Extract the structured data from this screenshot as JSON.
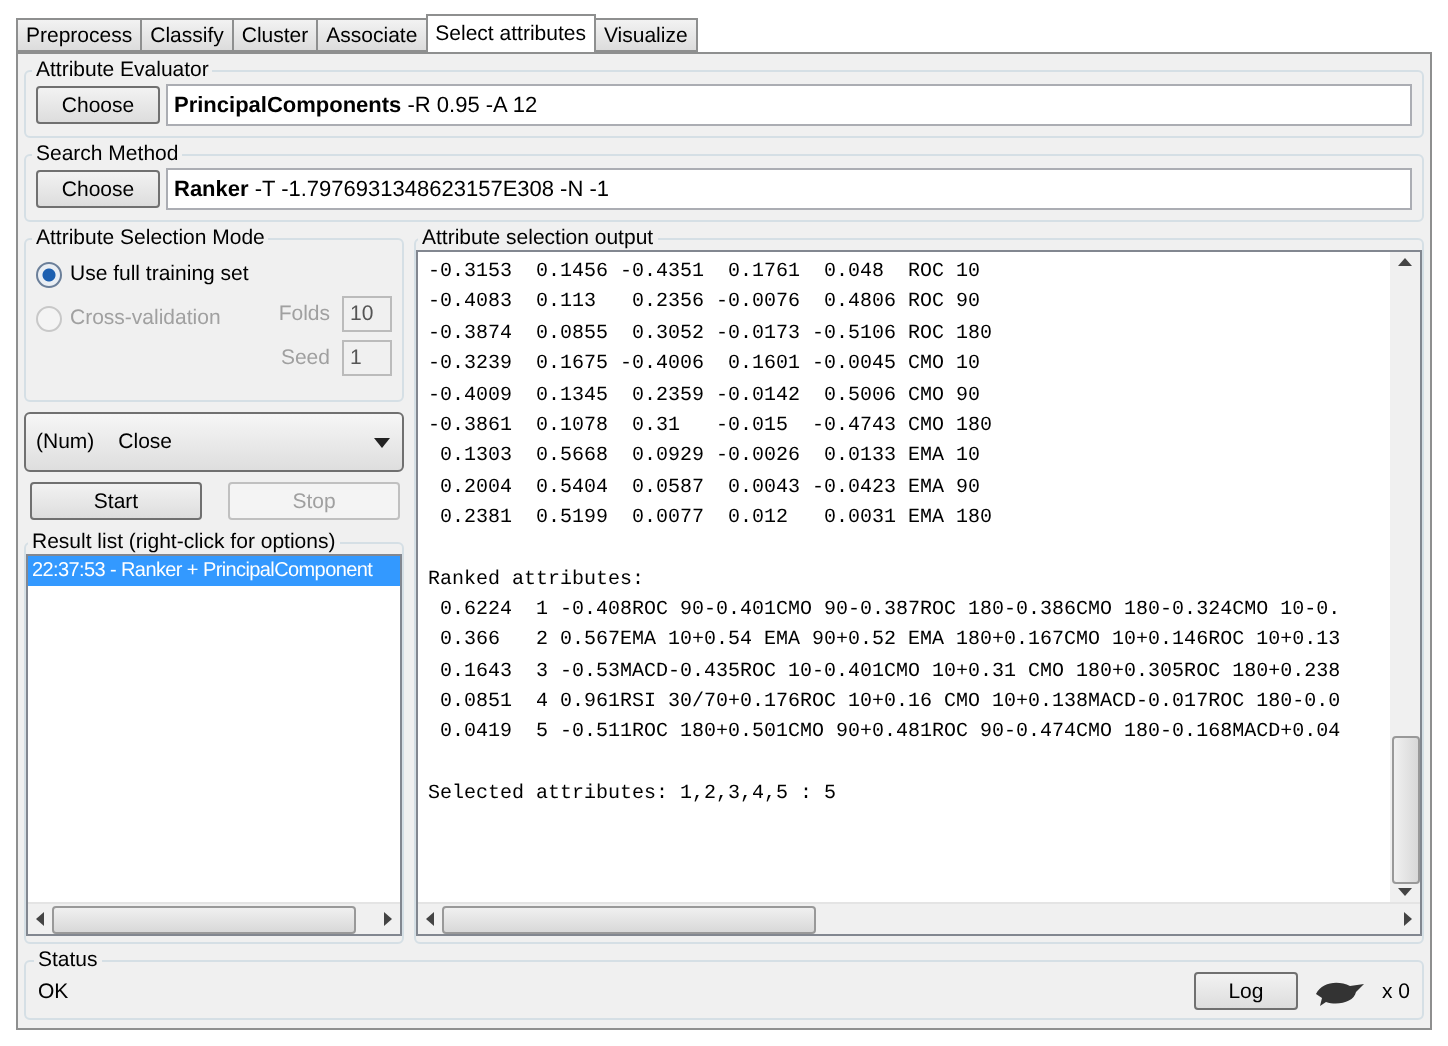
{
  "tabs": [
    {
      "label": "Preprocess",
      "selected": false
    },
    {
      "label": "Classify",
      "selected": false
    },
    {
      "label": "Cluster",
      "selected": false
    },
    {
      "label": "Associate",
      "selected": false
    },
    {
      "label": "Select attributes",
      "selected": true
    },
    {
      "label": "Visualize",
      "selected": false
    }
  ],
  "attribute_evaluator": {
    "title": "Attribute Evaluator",
    "button": "Choose",
    "value": "**PrincipalComponents** -R 0.95 -A 12"
  },
  "search_method": {
    "title": "Search Method",
    "button": "Choose",
    "value": "**Ranker** -T -1.7976931348623157E308 -N -1"
  },
  "selection_mode": {
    "title": "Attribute Selection Mode",
    "options": [
      {
        "label": "Use full training set",
        "selected": true,
        "disabled": false
      },
      {
        "label": "Cross-validation",
        "selected": false,
        "disabled": true
      }
    ],
    "fields": [
      {
        "label": "Folds",
        "value": "10",
        "disabled": true
      },
      {
        "label": "Seed",
        "value": "1",
        "disabled": true
      }
    ]
  },
  "class_dropdown": {
    "type": "(Num)",
    "value": "Close"
  },
  "buttons": [
    {
      "label": "Start",
      "disabled": false
    },
    {
      "label": "Stop",
      "disabled": true
    }
  ],
  "result_list": {
    "title": "Result list (right-click for options)",
    "items": [
      {
        "label": "22:37:53 - Ranker + PrincipalComponent",
        "selected": true
      }
    ]
  },
  "output": {
    "title": "Attribute selection output",
    "blocks": [
      {
        "lines": [
          "-0.3153  0.1456 -0.4351  0.1761  0.048  ROC 10",
          "-0.4083  0.113   0.2356 -0.0076  0.4806 ROC 90",
          "-0.3874  0.0855  0.3052 -0.0173 -0.5106 ROC 180",
          "-0.3239  0.1675 -0.4006  0.1601 -0.0045 CMO 10",
          "-0.4009  0.1345  0.2359 -0.0142  0.5006 CMO 90",
          "-0.3861  0.1078  0.31   -0.015  -0.4743 CMO 180",
          " 0.1303  0.5668  0.0929 -0.0026  0.0133 EMA 10",
          " 0.2004  0.5404  0.0587  0.0043 -0.0423 EMA 90",
          " 0.2381  0.5199  0.0077  0.012   0.0031 EMA 180"
        ]
      },
      {
        "lines": [
          "Ranked attributes:",
          " 0.6224  1 -0.408ROC 90-0.401CMO 90-0.387ROC 180-0.386CMO 180-0.324CMO 10-0.",
          " 0.366   2 0.567EMA 10+0.54 EMA 90+0.52 EMA 180+0.167CMO 10+0.146ROC 10+0.13",
          " 0.1643  3 -0.53MACD-0.435ROC 10-0.401CMO 10+0.31 CMO 180+0.305ROC 180+0.238",
          " 0.0851  4 0.961RSI 30/70+0.176ROC 10+0.16 CMO 10+0.138MACD-0.017ROC 180-0.0",
          " 0.0419  5 -0.511ROC 180+0.501CMO 90+0.481ROC 90-0.474CMO 180-0.168MACD+0.04"
        ]
      },
      {
        "lines": [
          "Selected attributes: 1,2,3,4,5 : 5"
        ]
      }
    ]
  },
  "status": {
    "title": "Status",
    "text": "OK",
    "log_button": "Log",
    "count": "x 0"
  }
}
